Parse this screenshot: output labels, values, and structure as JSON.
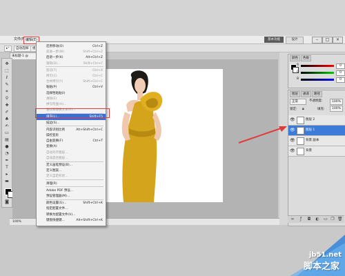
{
  "menubar": {
    "items": [
      "文件(F)",
      "编辑(E)"
    ],
    "essentials": "基本功能",
    "design": "设计"
  },
  "options": {
    "items": [
      "自动选择:",
      "组"
    ]
  },
  "document": {
    "tab": "未标题-1 @ 100%"
  },
  "status": {
    "zoom": "100%"
  },
  "edit_menu": {
    "items": [
      {
        "label": "还原移动(O)",
        "shortcut": "Ctrl+Z",
        "disabled": false
      },
      {
        "label": "前进一步(W)",
        "shortcut": "Shift+Ctrl+Z",
        "disabled": true
      },
      {
        "label": "后退一步(K)",
        "shortcut": "Alt+Ctrl+Z",
        "disabled": false
      },
      {
        "label": "渐隐(D)...",
        "shortcut": "Shift+Ctrl+F",
        "disabled": true
      },
      {
        "label": "剪切(T)",
        "shortcut": "Ctrl+X",
        "disabled": true
      },
      {
        "label": "拷贝(C)",
        "shortcut": "Ctrl+C",
        "disabled": true
      },
      {
        "label": "合并拷贝(Y)",
        "shortcut": "Shift+Ctrl+C",
        "disabled": true
      },
      {
        "label": "粘贴(P)",
        "shortcut": "Ctrl+V",
        "disabled": false
      },
      {
        "label": "选择性粘贴(I)",
        "shortcut": "",
        "disabled": false
      },
      {
        "label": "清除(E)",
        "shortcut": "",
        "disabled": true
      },
      {
        "label": "拼写检查(H)...",
        "shortcut": "",
        "disabled": true
      },
      {
        "label": "查找和替换文本(X)...",
        "shortcut": "",
        "disabled": true
      },
      {
        "label": "填充(L)...",
        "shortcut": "Shift+F5",
        "disabled": false,
        "highlight": true
      },
      {
        "label": "描边(S)...",
        "shortcut": "",
        "disabled": false
      },
      {
        "label": "内容识别比例",
        "shortcut": "Alt+Shift+Ctrl+C",
        "disabled": false
      },
      {
        "label": "操控变形",
        "shortcut": "",
        "disabled": false
      },
      {
        "label": "自由变换(F)",
        "shortcut": "Ctrl+T",
        "disabled": false
      },
      {
        "label": "变换(A)",
        "shortcut": "",
        "disabled": false
      },
      {
        "label": "自动对齐图层...",
        "shortcut": "",
        "disabled": true
      },
      {
        "label": "自动混合图层...",
        "shortcut": "",
        "disabled": true
      },
      {
        "label": "定义画笔预设(B)...",
        "shortcut": "",
        "disabled": false
      },
      {
        "label": "定义图案...",
        "shortcut": "",
        "disabled": false
      },
      {
        "label": "定义自定形状...",
        "shortcut": "",
        "disabled": true
      },
      {
        "label": "清理(R)",
        "shortcut": "",
        "disabled": false
      },
      {
        "label": "Adobe PDF 预设...",
        "shortcut": "",
        "disabled": false
      },
      {
        "label": "预设管理器(M)...",
        "shortcut": "",
        "disabled": false
      },
      {
        "label": "颜色设置(G)...",
        "shortcut": "Shift+Ctrl+K",
        "disabled": false
      },
      {
        "label": "指定配置文件...",
        "shortcut": "",
        "disabled": false
      },
      {
        "label": "转换为配置文件(V)...",
        "shortcut": "",
        "disabled": false
      },
      {
        "label": "键盘快捷键...",
        "shortcut": "Alt+Shift+Ctrl+K",
        "disabled": false
      }
    ]
  },
  "color_panel": {
    "tabs": [
      "颜色",
      "色板"
    ],
    "r_label": "R",
    "g_label": "G",
    "b_label": "B",
    "r": "0",
    "g": "0",
    "b": "0"
  },
  "layers_panel": {
    "tabs": [
      "图层",
      "通道",
      "路径"
    ],
    "blend_mode": "正常",
    "opacity_label": "不透明度:",
    "opacity": "100%",
    "lock_label": "锁定:",
    "fill_label": "填充:",
    "fill": "100%",
    "layers": [
      {
        "name": "图层 2",
        "selected": false
      },
      {
        "name": "图层 1",
        "selected": true
      },
      {
        "name": "背景 副本",
        "selected": false
      },
      {
        "name": "背景",
        "selected": false
      }
    ]
  },
  "watermark": {
    "url": "jb51.net",
    "name": "脚本之家"
  },
  "colors": {
    "highlight": "#3c6fd6",
    "accent_red": "#e03a3a",
    "dress": "#d4a41c",
    "selected_layer": "#3c7bd8"
  }
}
